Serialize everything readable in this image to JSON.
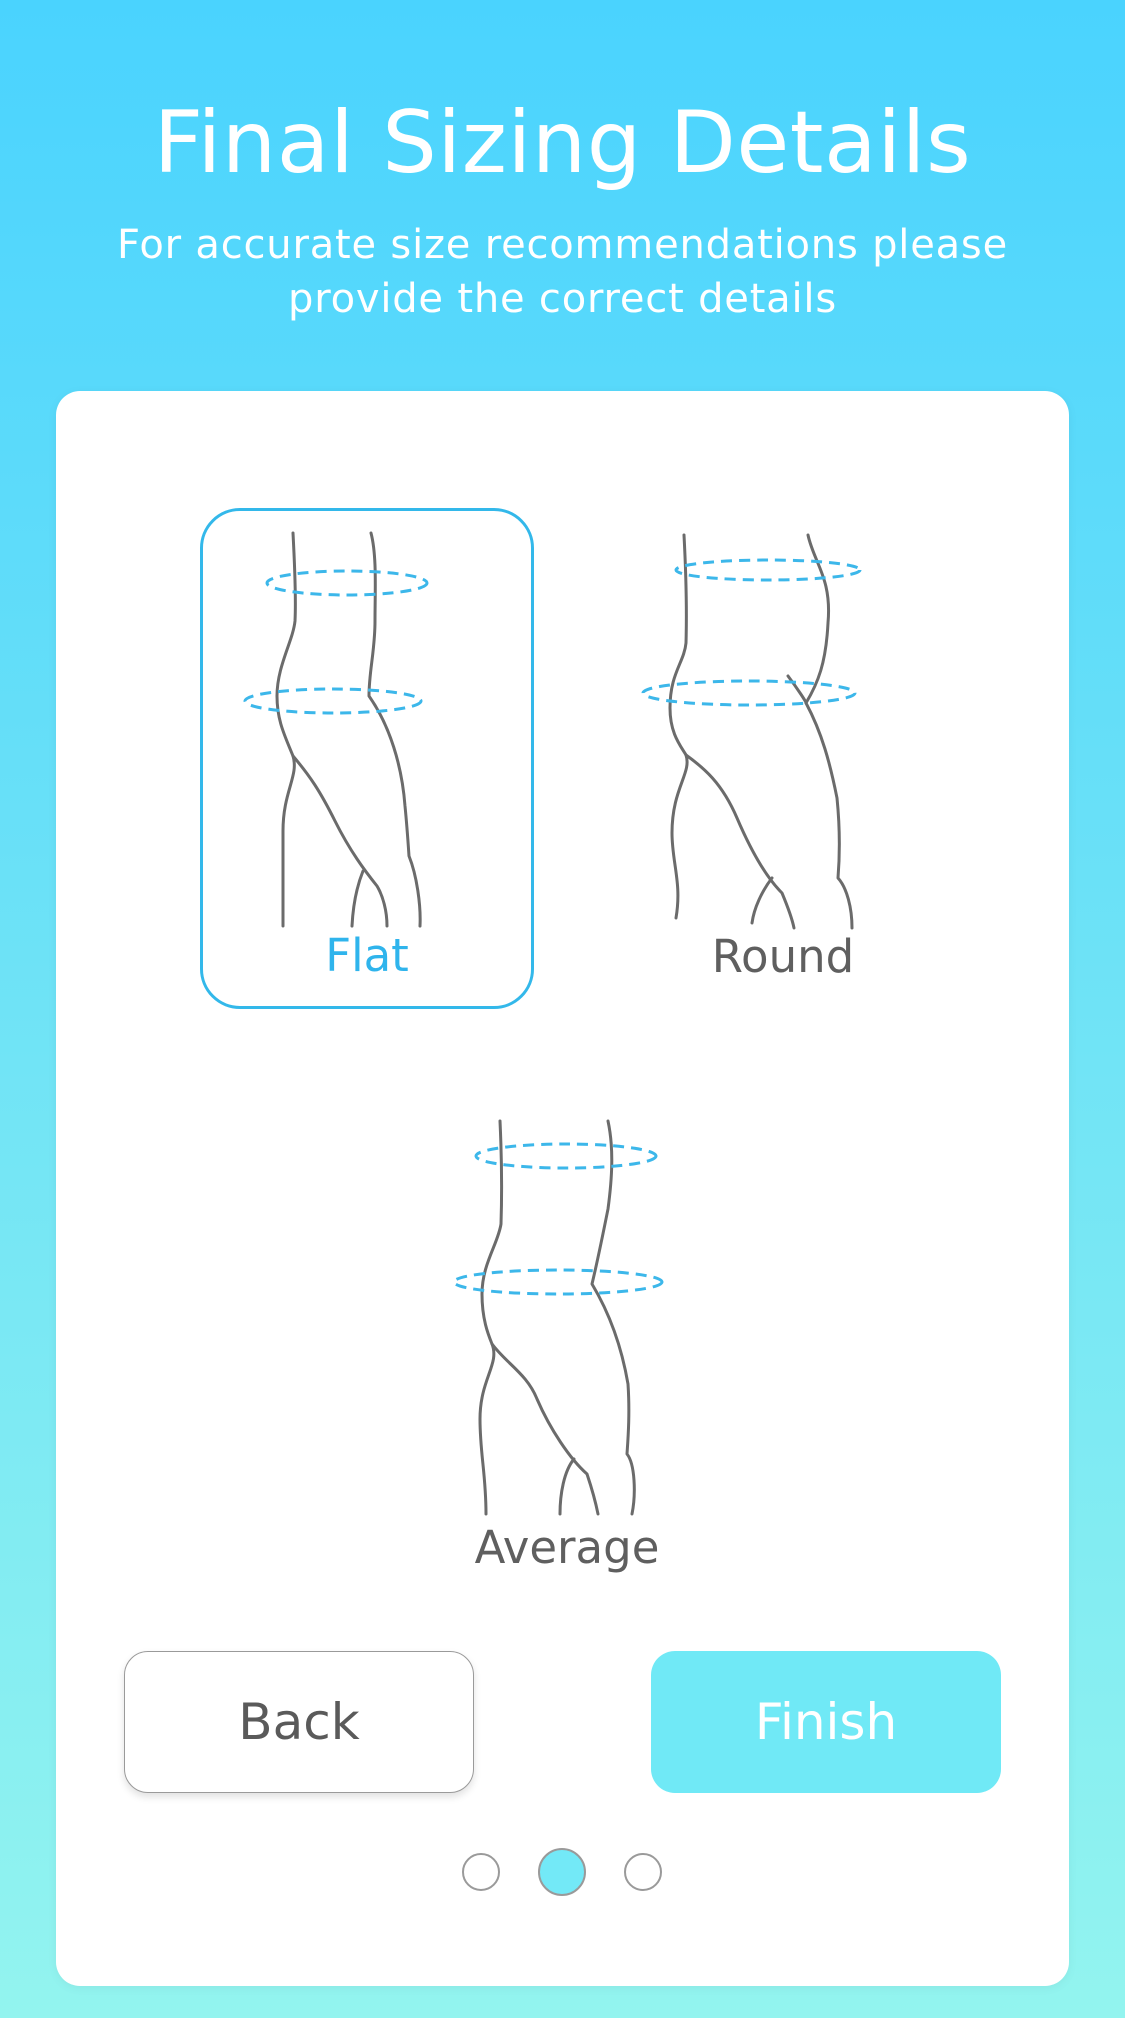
{
  "header": {
    "title": "Final Sizing Details",
    "subtitle": "For accurate size recommendations please provide the correct details"
  },
  "options": [
    {
      "label": "Flat",
      "selected": true
    },
    {
      "label": "Round",
      "selected": false
    },
    {
      "label": "Average",
      "selected": false
    }
  ],
  "buttons": {
    "back_label": "Back",
    "finish_label": "Finish"
  },
  "pagination": {
    "total": 3,
    "current": 2
  },
  "colors": {
    "accent": "#33b8ea",
    "finish_button": "#70e9f6",
    "measure_line": "#3cb7ea",
    "figure_stroke": "#6b6b6b"
  },
  "icons": {
    "flat": "flat-body-shape-icon",
    "round": "round-body-shape-icon",
    "average": "average-body-shape-icon"
  }
}
